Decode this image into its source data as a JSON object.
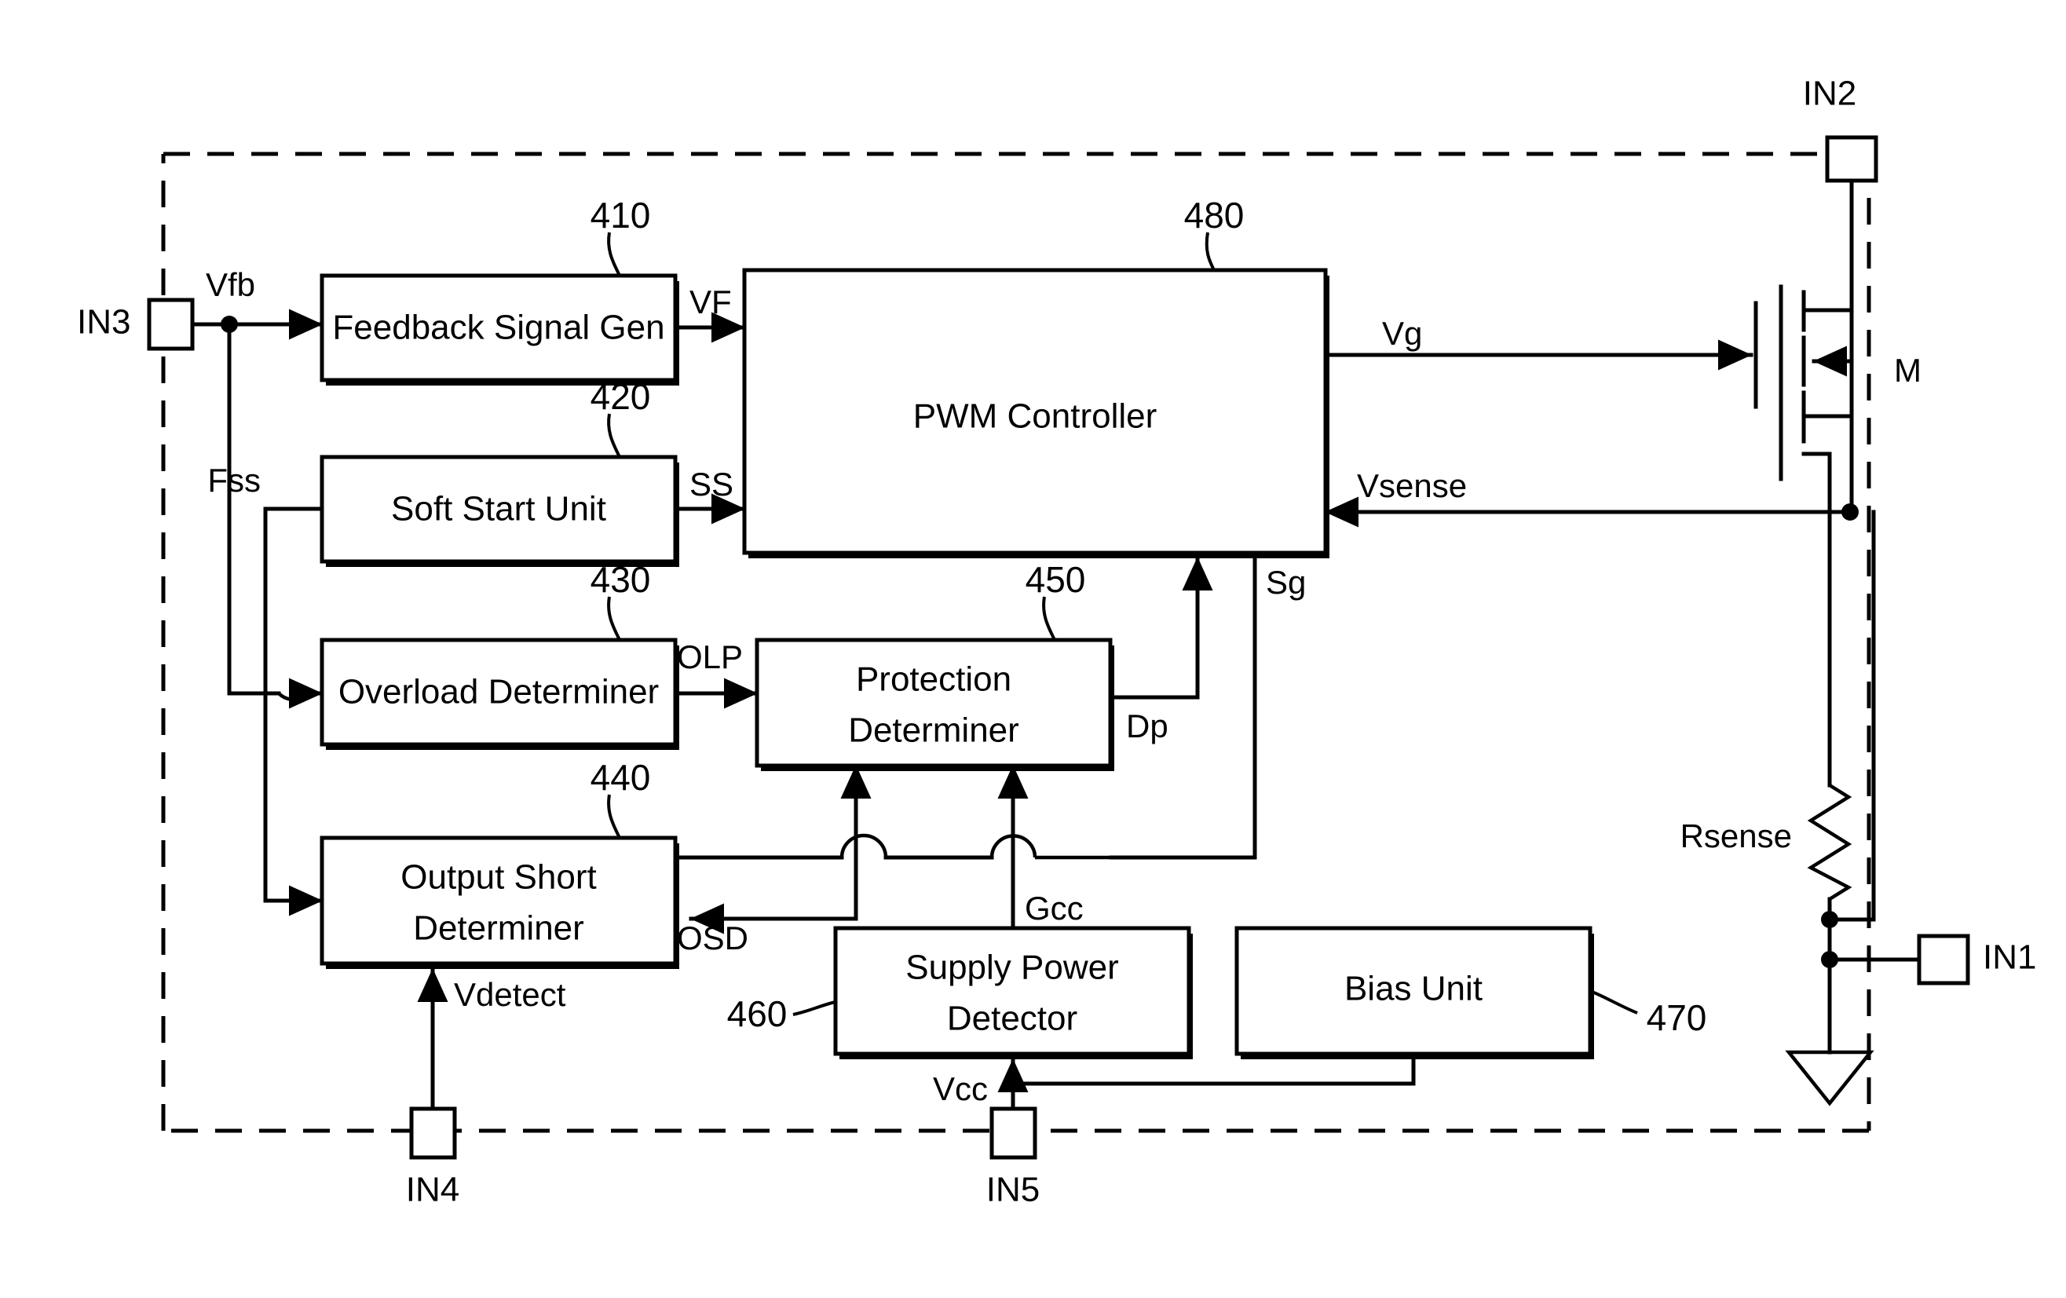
{
  "figure": {
    "type": "circuit-block-diagram",
    "title": "Switching Mode Power Supply Controller Block Diagram"
  },
  "blocks": [
    {
      "id": "feedback_signal_gen",
      "label": "Feedback Signal Gen",
      "ref": "410"
    },
    {
      "id": "soft_start_unit",
      "label": "Soft Start Unit",
      "ref": "420"
    },
    {
      "id": "overload_determiner",
      "label": "Overload Determiner",
      "ref": "430"
    },
    {
      "id": "output_short_determiner",
      "label_line1": "Output Short",
      "label_line2": "Determiner",
      "ref": "440"
    },
    {
      "id": "protection_determiner",
      "label_line1": "Protection",
      "label_line2": "Determiner",
      "ref": "450"
    },
    {
      "id": "supply_power_detector",
      "label_line1": "Supply Power",
      "label_line2": "Detector",
      "ref": "460"
    },
    {
      "id": "bias_unit",
      "label": "Bias Unit",
      "ref": "470"
    },
    {
      "id": "pwm_controller",
      "label": "PWM Controller",
      "ref": "480"
    }
  ],
  "terminals": [
    {
      "id": "in1",
      "label": "IN1"
    },
    {
      "id": "in2",
      "label": "IN2"
    },
    {
      "id": "in3",
      "label": "IN3"
    },
    {
      "id": "in4",
      "label": "IN4"
    },
    {
      "id": "in5",
      "label": "IN5"
    }
  ],
  "signals": [
    {
      "id": "vfb",
      "label": "Vfb"
    },
    {
      "id": "vf",
      "label": "VF"
    },
    {
      "id": "fss",
      "label": "Fss"
    },
    {
      "id": "ss",
      "label": "SS"
    },
    {
      "id": "olp",
      "label": "OLP"
    },
    {
      "id": "osd",
      "label": "OSD"
    },
    {
      "id": "dp",
      "label": "Dp"
    },
    {
      "id": "sg",
      "label": "Sg"
    },
    {
      "id": "gcc",
      "label": "Gcc"
    },
    {
      "id": "vcc",
      "label": "Vcc"
    },
    {
      "id": "vdetect",
      "label": "Vdetect"
    },
    {
      "id": "vg",
      "label": "Vg"
    },
    {
      "id": "vsense",
      "label": "Vsense"
    }
  ],
  "components": [
    {
      "id": "mosfet",
      "label": "M"
    },
    {
      "id": "rsense",
      "label": "Rsense"
    },
    {
      "id": "ground",
      "label": ""
    }
  ],
  "colors": {
    "line": "#000000",
    "background": "#ffffff",
    "text": "#000000"
  }
}
